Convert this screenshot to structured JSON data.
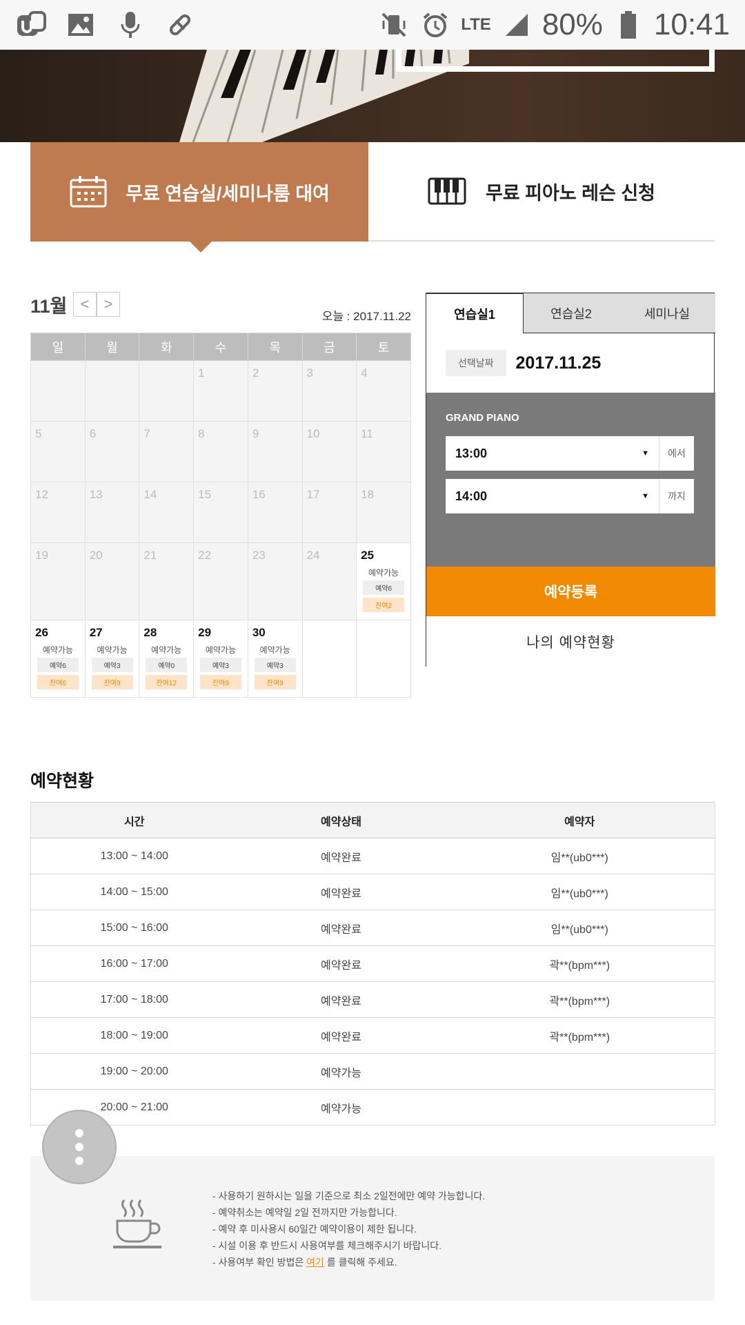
{
  "status_bar": {
    "battery": "80%",
    "time": "10:41",
    "network": "LTE",
    "left_icons": [
      "app-icon",
      "gallery-icon",
      "mic-icon",
      "pill-icon"
    ],
    "right_icons": [
      "mute-vibrate-icon",
      "alarm-icon",
      "signal-icon",
      "battery-icon"
    ]
  },
  "tabs": {
    "rental": "무료 연습실/세미나룸 대여",
    "lesson": "무료 피아노 레슨 신청"
  },
  "calendar": {
    "month": "11월",
    "prev": "<",
    "next": ">",
    "today": "오늘 : 2017.11.22",
    "weekdays": [
      "일",
      "월",
      "화",
      "수",
      "목",
      "금",
      "토"
    ],
    "available_label": "예약가능",
    "days": {
      "d1": "1",
      "d2": "2",
      "d3": "3",
      "d4": "4",
      "d5": "5",
      "d6": "6",
      "d7": "7",
      "d8": "8",
      "d9": "9",
      "d10": "10",
      "d11": "11",
      "d12": "12",
      "d13": "13",
      "d14": "14",
      "d15": "15",
      "d16": "16",
      "d17": "17",
      "d18": "18",
      "d19": "19",
      "d20": "20",
      "d21": "21",
      "d22": "22",
      "d23": "23",
      "d24": "24"
    },
    "available_days": [
      {
        "day": "25",
        "reserved": "예약6",
        "remaining": "잔여2"
      },
      {
        "day": "26",
        "reserved": "예약6",
        "remaining": "잔여6"
      },
      {
        "day": "27",
        "reserved": "예약3",
        "remaining": "잔여9"
      },
      {
        "day": "28",
        "reserved": "예약0",
        "remaining": "잔여12"
      },
      {
        "day": "29",
        "reserved": "예약3",
        "remaining": "잔여9"
      },
      {
        "day": "30",
        "reserved": "예약3",
        "remaining": "잔여9"
      }
    ]
  },
  "panel": {
    "tabs": [
      "연습실1",
      "연습실2",
      "세미나실"
    ],
    "date_label": "선택날짜",
    "date_value": "2017.11.25",
    "instrument": "GRAND PIANO",
    "start_time": "13:00",
    "start_suffix": "에서",
    "end_time": "14:00",
    "end_suffix": "까지",
    "book_button": "예약등록",
    "my_button": "나의 예약현황"
  },
  "reservations": {
    "title": "예약현황",
    "headers": [
      "시간",
      "예약상태",
      "예약자"
    ],
    "rows": [
      [
        "13:00 ~ 14:00",
        "예약완료",
        "임**(ub0***)"
      ],
      [
        "14:00 ~ 15:00",
        "예약완료",
        "임**(ub0***)"
      ],
      [
        "15:00 ~ 16:00",
        "예약완료",
        "임**(ub0***)"
      ],
      [
        "16:00 ~ 17:00",
        "예약완료",
        "곽**(bpm***)"
      ],
      [
        "17:00 ~ 18:00",
        "예약완료",
        "곽**(bpm***)"
      ],
      [
        "18:00 ~ 19:00",
        "예약완료",
        "곽**(bpm***)"
      ],
      [
        "19:00 ~ 20:00",
        "예약가능",
        ""
      ],
      [
        "20:00 ~ 21:00",
        "예약가능",
        ""
      ]
    ]
  },
  "notice": {
    "lines": [
      "- 사용하기 원하시는 일을 기준으로 최소 2일전에만 예약 가능합니다.",
      "- 예약취소는 예약일 2일 전까지만 가능합니다.",
      "- 예약 후 미사용시 60일간 예약이용이 제한 됩니다.",
      "- 시설 이용 후 반드시 사용여부를 체크해주시기 바랍니다."
    ],
    "last_prefix": "- 사용여부 확인 방법은 ",
    "last_link": "여기",
    "last_suffix": " 를 클릭해 주세요."
  }
}
